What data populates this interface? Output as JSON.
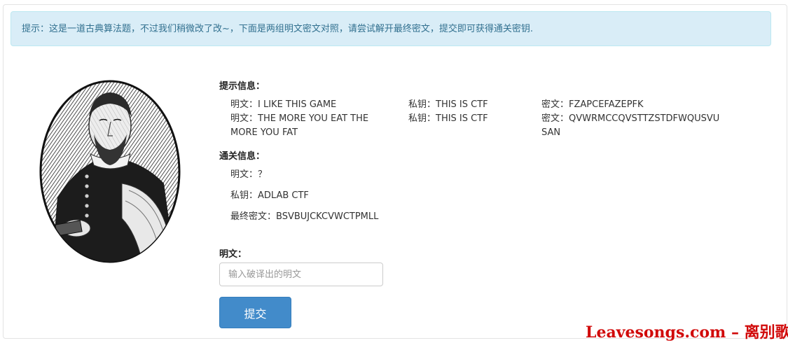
{
  "alert": {
    "text": "提示：这是一道古典算法题，不过我们稍微改了改~，下面是两组明文密文对照，请尝试解开最终密文，提交即可获得通关密钥."
  },
  "portrait": {
    "icon": "portrait-engraving"
  },
  "hint": {
    "heading": "提示信息：",
    "rows": [
      {
        "plain": "明文：I LIKE THIS GAME",
        "key": "私钥：THIS IS CTF",
        "cipher": "密文：FZAPCEFAZEPFK"
      },
      {
        "plain": "明文：THE MORE YOU EAT THE MORE YOU FAT",
        "key": "私钥：THIS IS CTF",
        "cipher": "密文：QVWRMCCQVSTTZSTDFWQUSVUSAN"
      }
    ]
  },
  "pass": {
    "heading": "通关信息：",
    "plain": "明文：？",
    "key": "私钥：ADLAB CTF",
    "final_cipher": "最终密文：BSVBUJCKCVWCTPMLL"
  },
  "form": {
    "label": "明文：",
    "placeholder": "输入破译出的明文",
    "submit_label": "提交"
  },
  "watermark": {
    "text": "Leavesongs.com – 离别歌"
  },
  "colors": {
    "alert_bg": "#d9edf7",
    "alert_text": "#31708f",
    "button": "#428bca",
    "watermark": "#d10a0a"
  }
}
